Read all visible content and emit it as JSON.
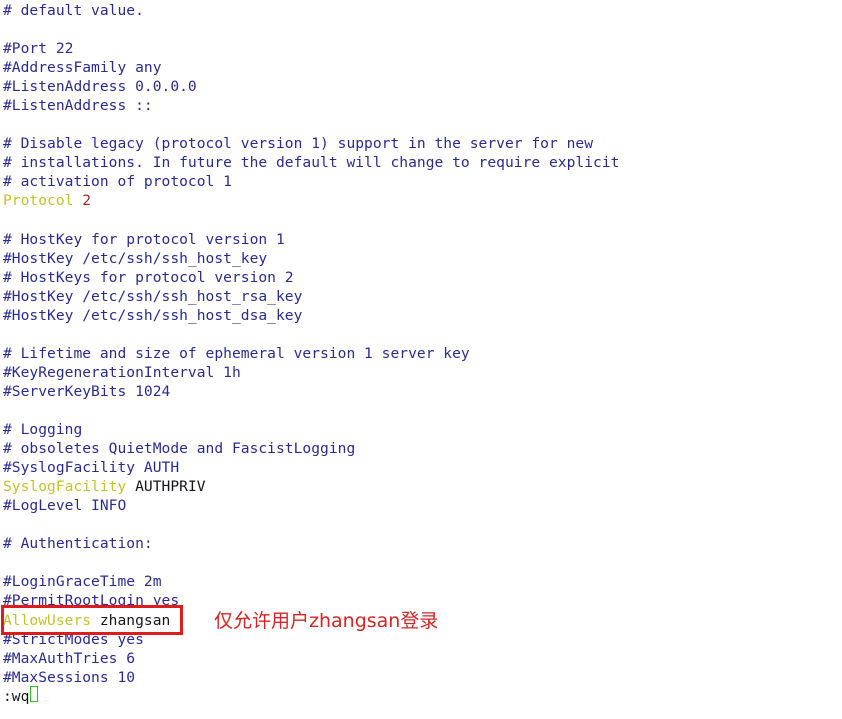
{
  "editor": {
    "kind": "vim-terminal-sshd-config",
    "background_color": "#ffffff",
    "colors": {
      "comment": "#2b2b8f",
      "keyword": "#c3c32e",
      "value": "#9e2b2b",
      "plain": "#16161a",
      "annotation": "#d62424",
      "highlight_border": "#e01b1b",
      "cursor_border": "#25c425"
    },
    "lines": [
      {
        "type": "comment",
        "text": "# default value."
      },
      {
        "type": "blank",
        "text": ""
      },
      {
        "type": "comment",
        "text": "#Port 22"
      },
      {
        "type": "comment",
        "text": "#AddressFamily any"
      },
      {
        "type": "comment",
        "text": "#ListenAddress 0.0.0.0"
      },
      {
        "type": "comment",
        "text": "#ListenAddress ::"
      },
      {
        "type": "blank",
        "text": ""
      },
      {
        "type": "comment",
        "text": "# Disable legacy (protocol version 1) support in the server for new"
      },
      {
        "type": "comment",
        "text": "# installations. In future the default will change to require explicit"
      },
      {
        "type": "comment",
        "text": "# activation of protocol 1"
      },
      {
        "type": "directive",
        "keyword": "Protocol",
        "value": " 2",
        "value_style": "value"
      },
      {
        "type": "blank",
        "text": ""
      },
      {
        "type": "comment",
        "text": "# HostKey for protocol version 1"
      },
      {
        "type": "comment",
        "text": "#HostKey /etc/ssh/ssh_host_key"
      },
      {
        "type": "comment",
        "text": "# HostKeys for protocol version 2"
      },
      {
        "type": "comment",
        "text": "#HostKey /etc/ssh/ssh_host_rsa_key"
      },
      {
        "type": "comment",
        "text": "#HostKey /etc/ssh/ssh_host_dsa_key"
      },
      {
        "type": "blank",
        "text": ""
      },
      {
        "type": "comment",
        "text": "# Lifetime and size of ephemeral version 1 server key"
      },
      {
        "type": "comment",
        "text": "#KeyRegenerationInterval 1h"
      },
      {
        "type": "comment",
        "text": "#ServerKeyBits 1024"
      },
      {
        "type": "blank",
        "text": ""
      },
      {
        "type": "comment",
        "text": "# Logging"
      },
      {
        "type": "comment",
        "text": "# obsoletes QuietMode and FascistLogging"
      },
      {
        "type": "comment",
        "text": "#SyslogFacility AUTH"
      },
      {
        "type": "directive",
        "keyword": "SyslogFacility",
        "value": " AUTHPRIV",
        "value_style": "plain"
      },
      {
        "type": "comment",
        "text": "#LogLevel INFO"
      },
      {
        "type": "blank",
        "text": ""
      },
      {
        "type": "comment",
        "text": "# Authentication:"
      },
      {
        "type": "blank",
        "text": ""
      },
      {
        "type": "comment",
        "text": "#LoginGraceTime 2m"
      },
      {
        "type": "comment",
        "text": "#PermitRootLogin yes"
      },
      {
        "type": "directive",
        "keyword": "AllowUsers",
        "value": " zhangsan",
        "value_style": "plain"
      },
      {
        "type": "comment",
        "text": "#StrictModes yes"
      },
      {
        "type": "comment",
        "text": "#MaxAuthTries 6"
      },
      {
        "type": "comment",
        "text": "#MaxSessions 10"
      },
      {
        "type": "command",
        "text": ":wq"
      }
    ]
  },
  "annotation": {
    "text": "仅允许用户zhangsan登录"
  },
  "highlight": {
    "target_line_text": "AllowUsers zhangsan"
  },
  "cursor": {
    "after_text": ":wq"
  }
}
